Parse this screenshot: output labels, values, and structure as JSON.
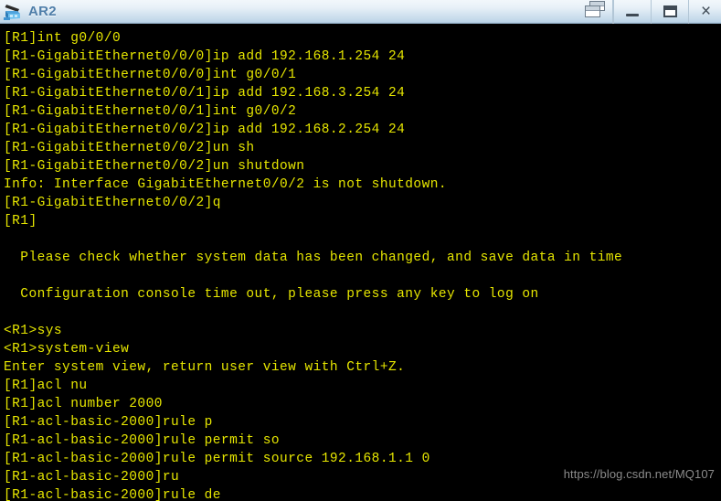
{
  "window": {
    "title": "AR2",
    "icon": "router-icon",
    "controls": [
      {
        "name": "cascade-button",
        "label": "",
        "icon": "cascade-windows-icon"
      },
      {
        "name": "minimize-button",
        "label": "",
        "icon": "minimize-icon"
      },
      {
        "name": "maximize-button",
        "label": "",
        "icon": "maximize-icon"
      },
      {
        "name": "close-button",
        "label": "×",
        "icon": "close-icon"
      }
    ]
  },
  "terminal": {
    "foreground_color": "#e6e600",
    "background_color": "#000000",
    "lines": [
      "[R1]int g0/0/0",
      "[R1-GigabitEthernet0/0/0]ip add 192.168.1.254 24",
      "[R1-GigabitEthernet0/0/0]int g0/0/1",
      "[R1-GigabitEthernet0/0/1]ip add 192.168.3.254 24",
      "[R1-GigabitEthernet0/0/1]int g0/0/2",
      "[R1-GigabitEthernet0/0/2]ip add 192.168.2.254 24",
      "[R1-GigabitEthernet0/0/2]un sh",
      "[R1-GigabitEthernet0/0/2]un shutdown",
      "Info: Interface GigabitEthernet0/0/2 is not shutdown.",
      "[R1-GigabitEthernet0/0/2]q",
      "[R1]",
      "",
      "  Please check whether system data has been changed, and save data in time",
      "",
      "  Configuration console time out, please press any key to log on",
      "",
      "<R1>sys",
      "<R1>system-view",
      "Enter system view, return user view with Ctrl+Z.",
      "[R1]acl nu",
      "[R1]acl number 2000",
      "[R1-acl-basic-2000]rule p",
      "[R1-acl-basic-2000]rule permit so",
      "[R1-acl-basic-2000]rule permit source 192.168.1.1 0",
      "[R1-acl-basic-2000]ru",
      "[R1-acl-basic-2000]rule de"
    ]
  },
  "watermark": {
    "text": "https://blog.csdn.net/MQ107",
    "color": "#8b8b8b"
  }
}
